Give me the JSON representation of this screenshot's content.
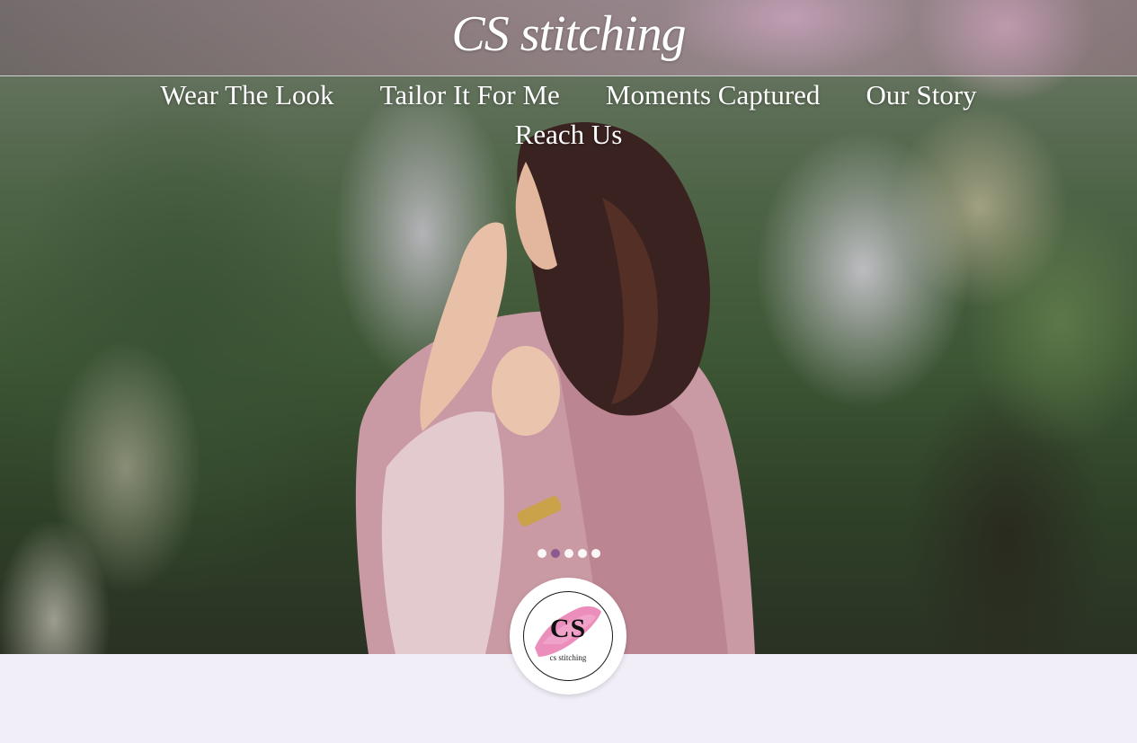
{
  "header": {
    "brand": "CS stitching"
  },
  "nav": {
    "items": [
      {
        "label": "Wear The Look"
      },
      {
        "label": "Tailor It For Me"
      },
      {
        "label": "Moments Captured"
      },
      {
        "label": "Our Story"
      },
      {
        "label": "Reach Us"
      }
    ]
  },
  "slider": {
    "slide_count": 5,
    "active_index": 1
  },
  "logo": {
    "monogram": "CS",
    "subtitle": "cs stitching"
  },
  "colors": {
    "page_background": "#f1eef8",
    "nav_text": "#ffffff",
    "dot_active": "#8b5a8f",
    "logo_brush": "#e97ab0"
  },
  "icons": {
    "slider_dot": "slider-dot-icon"
  }
}
